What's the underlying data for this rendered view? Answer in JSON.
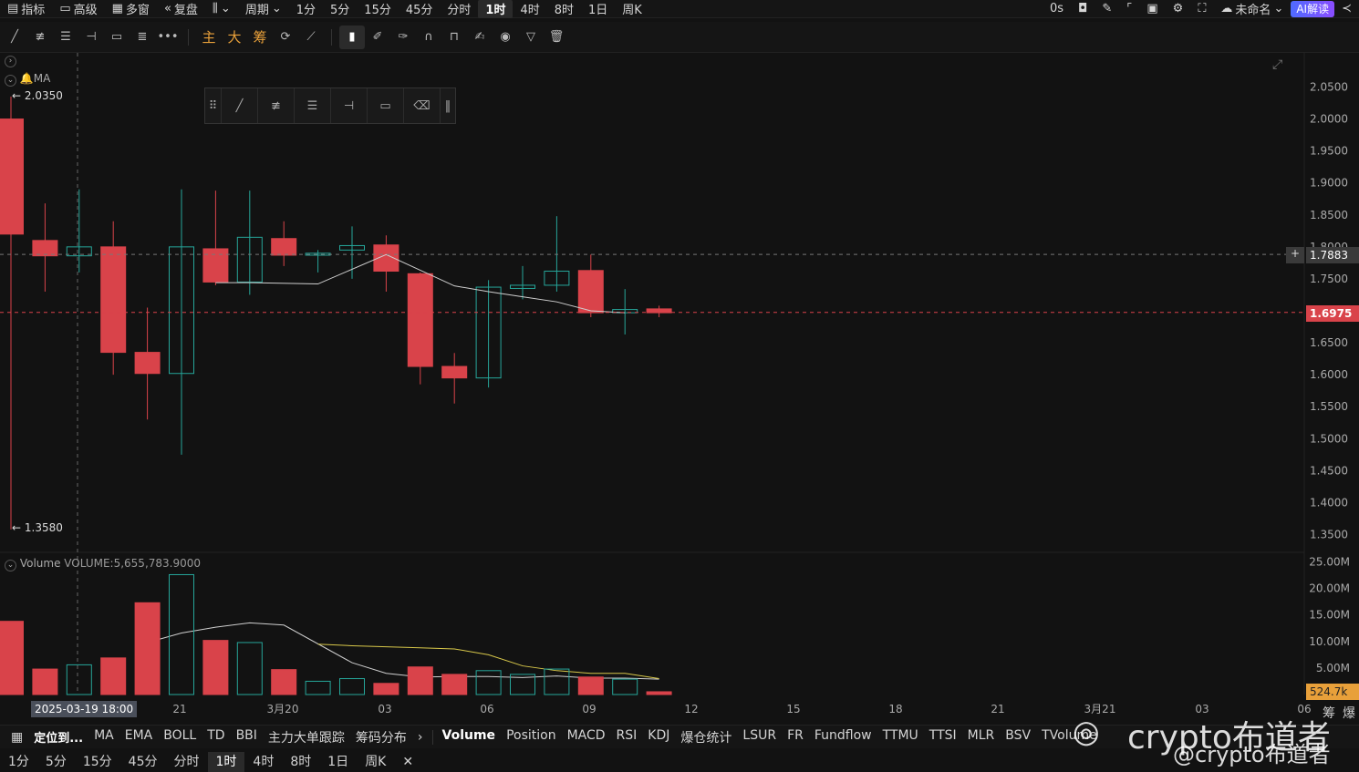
{
  "topbar": {
    "left": [
      {
        "name": "indicators",
        "label": "指标",
        "icon": "chart-icon"
      },
      {
        "name": "advanced",
        "label": "高级",
        "icon": "window-icon"
      },
      {
        "name": "multi-window",
        "label": "多窗",
        "icon": "grid-icon"
      },
      {
        "name": "replay",
        "label": "复盘",
        "icon": "rewind-icon"
      },
      {
        "name": "chart-type",
        "label": "",
        "icon": "candle-icon"
      },
      {
        "name": "period",
        "label": "周期",
        "icon": ""
      }
    ],
    "periods": [
      "1分",
      "5分",
      "15分",
      "45分",
      "分时",
      "1时",
      "4时",
      "8时",
      "1日",
      "周K"
    ],
    "active_period": "1时",
    "countdown": "0s",
    "layout_name": "未命名",
    "ai_label": "AI解读"
  },
  "toolbar": {
    "gold_items": [
      "主",
      "大",
      "筹"
    ]
  },
  "main_chart": {
    "ma_label": "MA",
    "high_label": "← 2.0350",
    "low_label": "← 1.3580",
    "crosshair_price": "1.7883",
    "last_price": "1.6975",
    "y_ticks": [
      "2.0500",
      "2.0000",
      "1.9500",
      "1.9000",
      "1.8500",
      "1.8000",
      "1.7500",
      "1.7000",
      "1.6500",
      "1.6000",
      "1.5500",
      "1.5000",
      "1.4500",
      "1.4000",
      "1.3500"
    ]
  },
  "volume_panel": {
    "title": "Volume",
    "value_label": "VOLUME:5,655,783.9000",
    "y_ticks": [
      "25.00M",
      "20.00M",
      "15.00M",
      "10.00M",
      "5.00M"
    ],
    "last_volume": "524.7k"
  },
  "x_axis": {
    "crosshair_date": "2025-03-19 18:00",
    "ticks": [
      "21",
      "3月20",
      "03",
      "06",
      "09",
      "12",
      "15",
      "18",
      "21",
      "3月21",
      "03",
      "06"
    ],
    "right_labels": [
      "筹",
      "爆"
    ]
  },
  "indicator_bar": {
    "locate_label": "定位到...",
    "main_items": [
      "MA",
      "EMA",
      "BOLL",
      "TD",
      "BBI",
      "主力大单跟踪",
      "筹码分布"
    ],
    "sub_items": [
      "Volume",
      "Position",
      "MACD",
      "RSI",
      "KDJ",
      "爆仓统计",
      "LSUR",
      "FR",
      "Fundflow",
      "TTMU",
      "TTSI",
      "MLR",
      "BSV",
      "TVolume"
    ],
    "active_sub": "Volume"
  },
  "period_bar": {
    "items": [
      "1分",
      "5分",
      "15分",
      "45分",
      "分时",
      "1时",
      "4时",
      "8时",
      "1日",
      "周K"
    ],
    "active": "1时"
  },
  "watermark": {
    "line1": "crypto布道者",
    "line2": "@crypto布道者"
  },
  "colors": {
    "up": "#26a69a",
    "down": "#d9434a",
    "bg": "#121212",
    "ma": "#cfcfcf",
    "ma2": "#d8c84a",
    "accent": "#e8a03a"
  },
  "chart_data": {
    "type": "candlestick",
    "interval": "1时",
    "ylim": [
      1.33,
      2.07
    ],
    "candles": [
      {
        "o": 2.0,
        "h": 2.035,
        "l": 1.358,
        "c": 1.82
      },
      {
        "o": 1.81,
        "h": 1.868,
        "l": 1.73,
        "c": 1.786
      },
      {
        "o": 1.786,
        "h": 1.89,
        "l": 1.76,
        "c": 1.8
      },
      {
        "o": 1.8,
        "h": 1.84,
        "l": 1.6,
        "c": 1.635
      },
      {
        "o": 1.635,
        "h": 1.705,
        "l": 1.53,
        "c": 1.602
      },
      {
        "o": 1.602,
        "h": 1.89,
        "l": 1.475,
        "c": 1.8
      },
      {
        "o": 1.797,
        "h": 1.888,
        "l": 1.74,
        "c": 1.745
      },
      {
        "o": 1.745,
        "h": 1.888,
        "l": 1.725,
        "c": 1.815
      },
      {
        "o": 1.813,
        "h": 1.84,
        "l": 1.77,
        "c": 1.787
      },
      {
        "o": 1.787,
        "h": 1.795,
        "l": 1.76,
        "c": 1.79
      },
      {
        "o": 1.795,
        "h": 1.832,
        "l": 1.75,
        "c": 1.802
      },
      {
        "o": 1.803,
        "h": 1.818,
        "l": 1.73,
        "c": 1.762
      },
      {
        "o": 1.758,
        "h": 1.76,
        "l": 1.585,
        "c": 1.613
      },
      {
        "o": 1.613,
        "h": 1.634,
        "l": 1.555,
        "c": 1.595
      },
      {
        "o": 1.595,
        "h": 1.748,
        "l": 1.58,
        "c": 1.737
      },
      {
        "o": 1.735,
        "h": 1.77,
        "l": 1.718,
        "c": 1.74
      },
      {
        "o": 1.74,
        "h": 1.848,
        "l": 1.73,
        "c": 1.762
      },
      {
        "o": 1.763,
        "h": 1.788,
        "l": 1.69,
        "c": 1.697
      },
      {
        "o": 1.697,
        "h": 1.734,
        "l": 1.663,
        "c": 1.702
      },
      {
        "o": 1.703,
        "h": 1.708,
        "l": 1.69,
        "c": 1.697
      }
    ],
    "ma": [
      null,
      null,
      null,
      null,
      null,
      null,
      1.744,
      1.744,
      null,
      1.742,
      null,
      1.788,
      null,
      1.739,
      1.73,
      1.722,
      1.714,
      1.7,
      1.697,
      null
    ],
    "volume": [
      13.8,
      4.8,
      5.6,
      6.9,
      17.3,
      22.6,
      10.2,
      9.8,
      4.7,
      2.5,
      3.0,
      2.1,
      5.2,
      3.8,
      4.5,
      3.8,
      4.8,
      3.3,
      2.9,
      0.52
    ],
    "volume_ylim": [
      0,
      27
    ],
    "volume_ma": [
      null,
      null,
      null,
      null,
      9.8,
      11.6,
      12.7,
      13.5,
      13.1,
      null,
      6.0,
      4.0,
      3.3,
      3.4,
      3.4,
      3.2,
      3.5,
      3.1,
      3.1,
      2.9
    ],
    "volume_ma2": [
      null,
      null,
      null,
      null,
      null,
      null,
      null,
      null,
      null,
      9.5,
      9.2,
      null,
      8.8,
      8.6,
      7.5,
      5.4,
      4.5,
      4.0,
      4.0,
      3.0
    ]
  }
}
